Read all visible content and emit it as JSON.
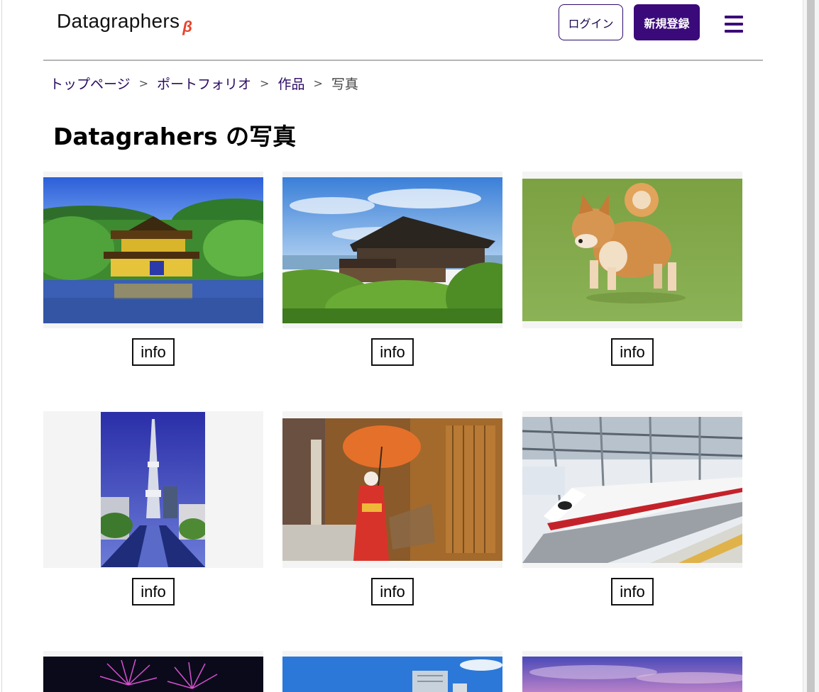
{
  "header": {
    "logo": "Datagraphers",
    "beta": "β",
    "login_label": "ログイン",
    "signup_label": "新規登録",
    "menu_icon": "hamburger-menu-icon"
  },
  "breadcrumb": {
    "items": [
      "トップページ",
      "ポートフォリオ",
      "作品",
      "写真"
    ],
    "separator": ">"
  },
  "page": {
    "title": "Datagrahers の写真"
  },
  "gallery": {
    "info_label": "info",
    "photos": [
      {
        "subject": "golden pavilion temple"
      },
      {
        "subject": "wooden temple on hillside"
      },
      {
        "subject": "shiba inu running"
      },
      {
        "subject": "tokyo skytree tower"
      },
      {
        "subject": "maiko with red umbrella"
      },
      {
        "subject": "shinkansen train"
      },
      {
        "subject": "fireworks"
      },
      {
        "subject": "city buildings"
      },
      {
        "subject": "evening sky"
      }
    ]
  },
  "colors": {
    "brand": "#3b0a7a",
    "beta": "#e8432b",
    "frame_bg": "#f4f4f5"
  }
}
